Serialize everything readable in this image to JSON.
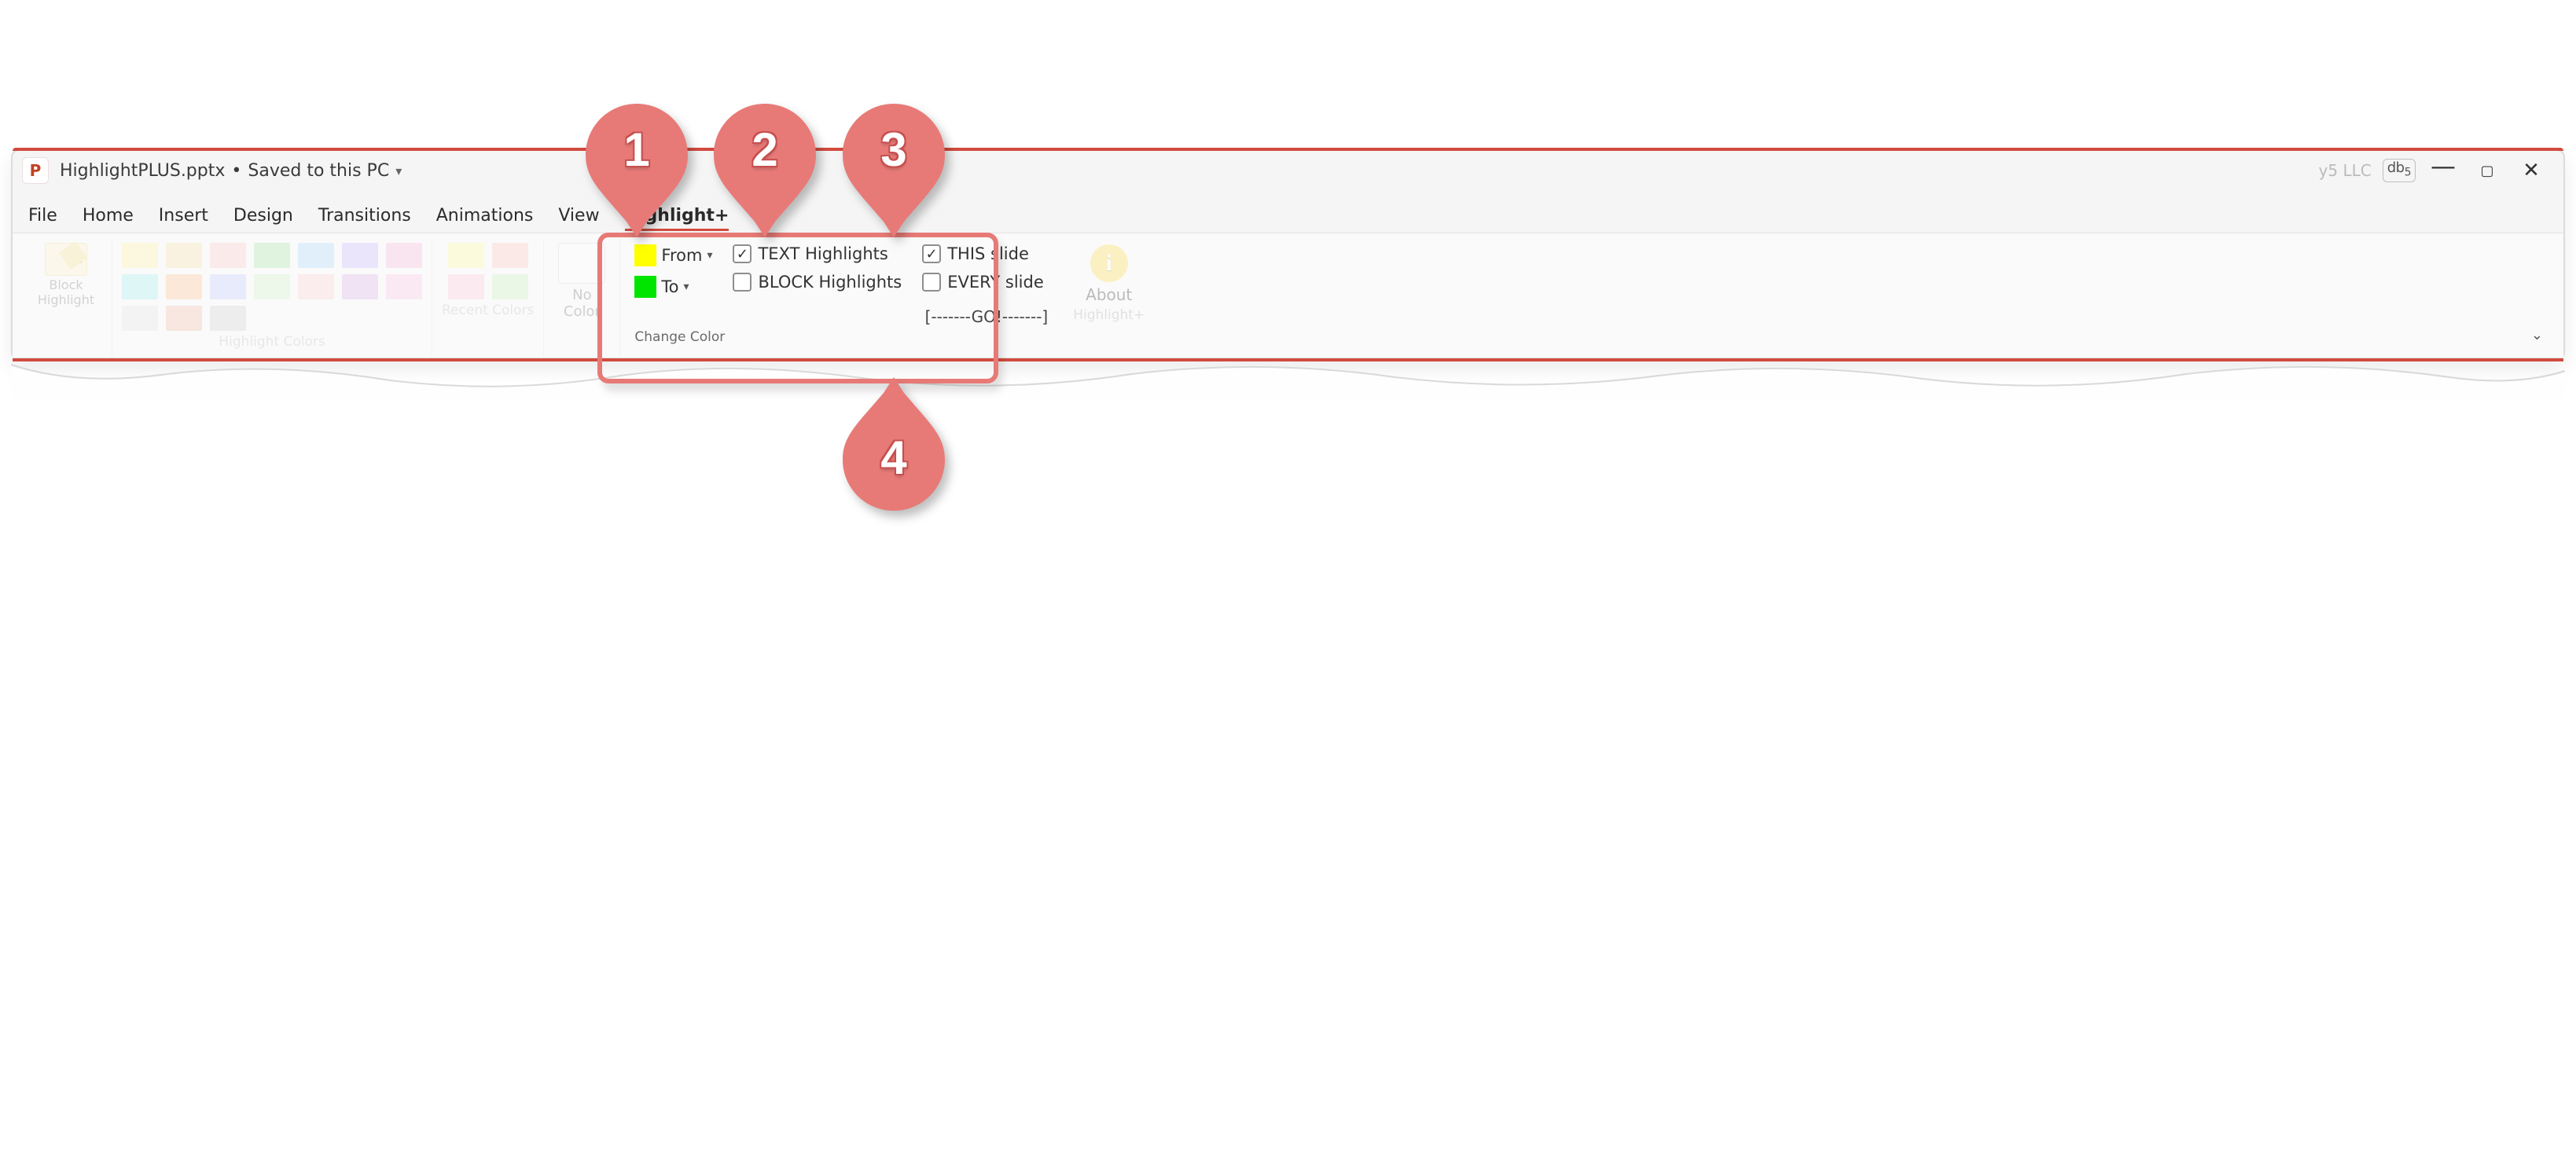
{
  "title": {
    "filename": "HighlightPLUS.pptx",
    "saved_status": "Saved to this PC",
    "company_suffix": "y5 LLC",
    "user_badge": "db5"
  },
  "tabs": {
    "file": "File",
    "home": "Home",
    "insert": "Insert",
    "design": "Design",
    "transitions": "Transitions",
    "animations": "Animations",
    "view": "View",
    "highlight_plus": "Highlight+"
  },
  "ribbon": {
    "block_highlight": {
      "line1": "Block",
      "line2": "Highlight"
    },
    "highlight_colors": {
      "label": "Highlight Colors",
      "swatches": [
        "#fff6a3",
        "#fde1a8",
        "#fbc9c7",
        "#a4e6a4",
        "#a8d7ff",
        "#cbb7ff",
        "#f8b8da",
        "#a1f0ee",
        "#fec28c",
        "#c0ccff",
        "#d1f1c7",
        "#fecdd0",
        "#d7afe7",
        "#fac4e0",
        "#e6e6e6",
        "#f4baa7",
        "#d2d2d2"
      ]
    },
    "recent_colors": {
      "label": "Recent Colors",
      "swatches": [
        "#fffb99",
        "#ffc3c1",
        "#fec6d9",
        "#c9f3bb"
      ]
    },
    "no_color": {
      "line1": "No",
      "line2": "Color"
    },
    "change_color": {
      "from_label": "From",
      "from_color": "#ffff00",
      "to_label": "To",
      "to_color": "#00e500",
      "text_highlights": {
        "label": "TEXT Highlights",
        "checked": true
      },
      "block_highlights": {
        "label": "BLOCK Highlights",
        "checked": false
      },
      "this_slide": {
        "label": "THIS slide",
        "checked": true
      },
      "every_slide": {
        "label": "EVERY slide",
        "checked": false
      },
      "go_label": "[-------GO!-------]",
      "group_label": "Change Color"
    },
    "about": {
      "label": "About",
      "group_label": "Highlight+"
    }
  },
  "callouts": {
    "c1": "1",
    "c2": "2",
    "c3": "3",
    "c4": "4"
  }
}
